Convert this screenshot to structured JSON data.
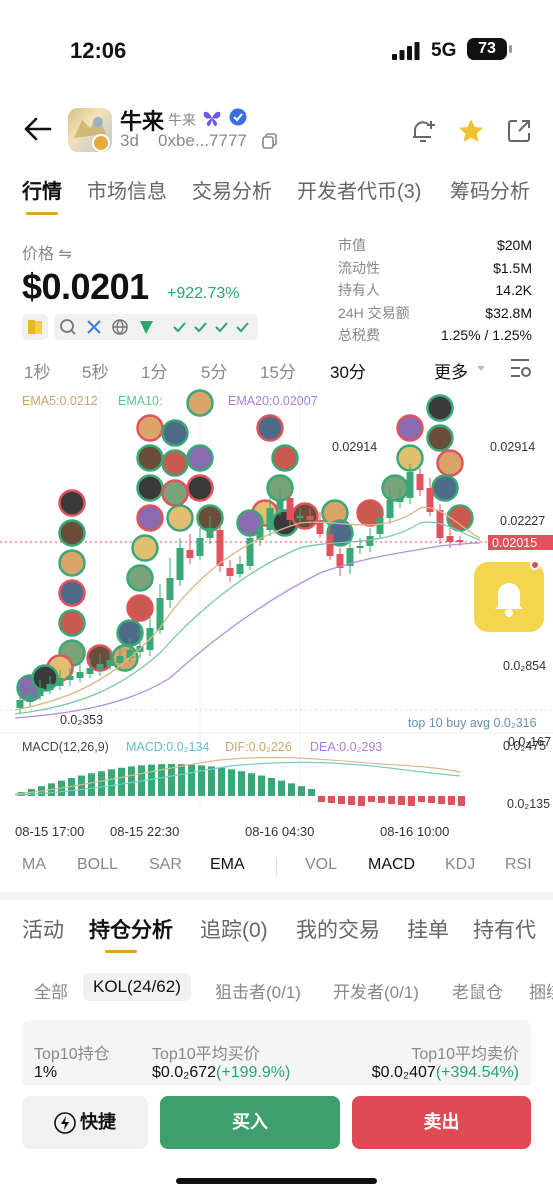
{
  "status_bar": {
    "time": "12:06",
    "network": "5G",
    "battery": "73"
  },
  "header": {
    "token_name": "牛来",
    "token_subname": "牛来",
    "age": "3d",
    "address": "0xbe...7777"
  },
  "main_tabs": [
    {
      "label": "行情",
      "active": true
    },
    {
      "label": "市场信息"
    },
    {
      "label": "交易分析"
    },
    {
      "label": "开发者代币(3)"
    },
    {
      "label": "筹码分析"
    }
  ],
  "price": {
    "label": "价格 ⇋",
    "value": "$0.0201",
    "change": "+922.73%"
  },
  "stats": [
    {
      "key": "市值",
      "value": "$20M"
    },
    {
      "key": "流动性",
      "value": "$1.5M"
    },
    {
      "key": "持有人",
      "value": "14.2K"
    },
    {
      "key": "24H 交易额",
      "value": "$32.8M"
    },
    {
      "key": "总税费",
      "value": "1.25% / 1.25%"
    }
  ],
  "intervals": [
    {
      "label": "1秒"
    },
    {
      "label": "5秒"
    },
    {
      "label": "1分"
    },
    {
      "label": "5分"
    },
    {
      "label": "15分"
    },
    {
      "label": "30分",
      "active": true
    },
    {
      "label": "更多"
    }
  ],
  "chart": {
    "ema_labels": {
      "ema5": "EMA5:0.0212",
      "ema10": "EMA10:",
      "ema20": "EMA20:0.02007"
    },
    "price_ticks": [
      "0.02914",
      "0.02227",
      "0.0₂854",
      "0.0₂167"
    ],
    "current_price": "0.02015",
    "high_annot": "0.02914",
    "low_annot": "0.0₂353",
    "top10_annot": "top 10 buy avg 0.0₂316",
    "macd_labels": {
      "name": "MACD(12,26,9)",
      "macd": "MACD:0.0₂134",
      "dif": "DIF:0.0₂226",
      "dea": "DEA:0.0₂293"
    },
    "macd_ticks": [
      "0.0₂475",
      "0.0₂135"
    ],
    "time_ticks": [
      "08-15 17:00",
      "08-15 22:30",
      "08-16 04:30",
      "08-16 10:00"
    ],
    "colors": {
      "up": "#3aa876",
      "down": "#e0535c",
      "ema5": "#d7b98a",
      "ema10": "#7ac8a4",
      "ema20": "#b58ee0"
    }
  },
  "indicators": [
    {
      "label": "MA"
    },
    {
      "label": "BOLL"
    },
    {
      "label": "SAR"
    },
    {
      "label": "EMA",
      "active": true
    },
    {
      "label": "VOL"
    },
    {
      "label": "MACD",
      "active": true
    },
    {
      "label": "KDJ"
    },
    {
      "label": "RSI"
    }
  ],
  "bottom_tabs": [
    {
      "label": "活动"
    },
    {
      "label": "持仓分析",
      "active": true
    },
    {
      "label": "追踪(0)"
    },
    {
      "label": "我的交易"
    },
    {
      "label": "挂单"
    },
    {
      "label": "持有代"
    }
  ],
  "filter_tabs": [
    {
      "label": "全部"
    },
    {
      "label": "KOL(24/62)",
      "active": true
    },
    {
      "label": "狙击者(0/1)"
    },
    {
      "label": "开发者(0/1)"
    },
    {
      "label": "老鼠仓"
    },
    {
      "label": "捆绑"
    }
  ],
  "summary_card": {
    "holding_label": "Top10持仓",
    "holding_value": "1%",
    "buy_label": "Top10平均买价",
    "buy_value": "$0.0₂672",
    "buy_change": "(+199.9%)",
    "sell_label": "Top10平均卖价",
    "sell_value": "$0.0₂407",
    "sell_change": "(+394.54%)"
  },
  "actions": {
    "quick": "快捷",
    "buy": "买入",
    "sell": "卖出"
  }
}
